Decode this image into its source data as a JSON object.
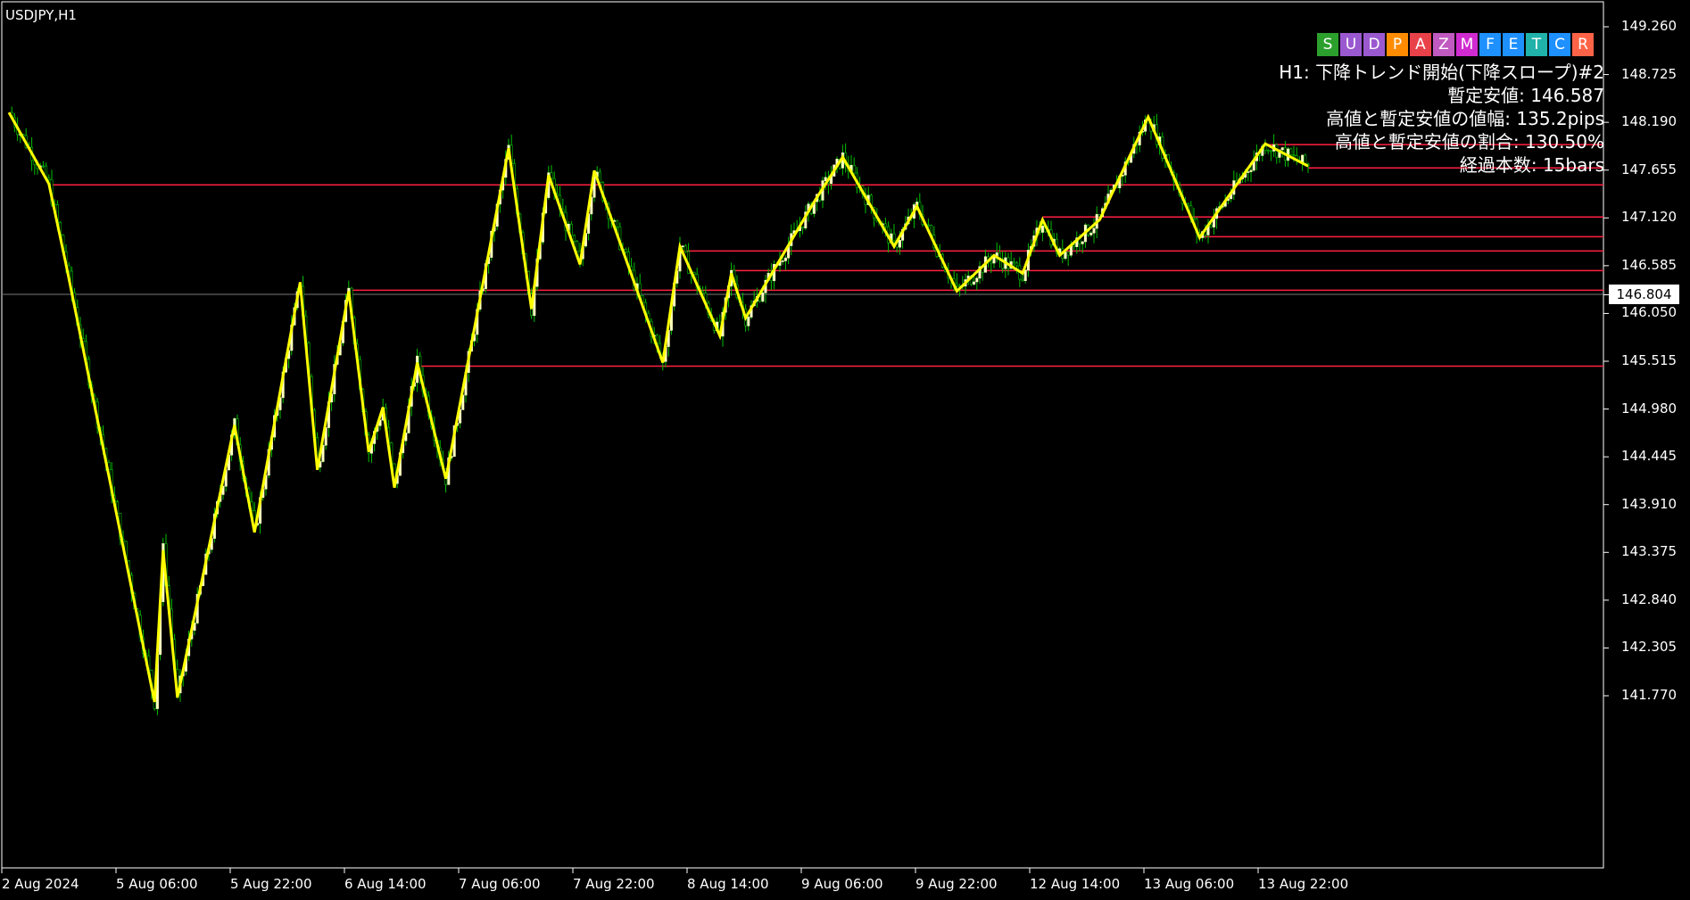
{
  "window": {
    "symbol_title": "USDJPY,H1"
  },
  "price_axis": {
    "ticks": [
      "149.260",
      "148.725",
      "148.190",
      "147.655",
      "147.120",
      "146.585",
      "146.050",
      "145.515",
      "144.980",
      "144.445",
      "143.910",
      "143.375",
      "142.840",
      "142.305",
      "141.770"
    ],
    "current_price": "146.804"
  },
  "time_axis": {
    "labels": [
      "2 Aug 2024",
      "5 Aug 06:00",
      "5 Aug 22:00",
      "6 Aug 14:00",
      "7 Aug 06:00",
      "7 Aug 22:00",
      "8 Aug 14:00",
      "9 Aug 06:00",
      "9 Aug 22:00",
      "12 Aug 14:00",
      "13 Aug 06:00",
      "13 Aug 22:00"
    ]
  },
  "indicator_buttons": [
    {
      "label": "S",
      "color": "#2ca02c"
    },
    {
      "label": "U",
      "color": "#9b59d0"
    },
    {
      "label": "D",
      "color": "#9b59d0"
    },
    {
      "label": "P",
      "color": "#ff8c00"
    },
    {
      "label": "A",
      "color": "#e8414a"
    },
    {
      "label": "Z",
      "color": "#c05ac0"
    },
    {
      "label": "M",
      "color": "#d02bd0"
    },
    {
      "label": "F",
      "color": "#1e90ff"
    },
    {
      "label": "E",
      "color": "#1e90ff"
    },
    {
      "label": "T",
      "color": "#20b2aa"
    },
    {
      "label": "C",
      "color": "#1e90ff"
    },
    {
      "label": "R",
      "color": "#ff6347"
    }
  ],
  "info_panel": {
    "line1": "H1: 下降トレンド開始(下降スロープ)#2",
    "line2": "暫定安値: 146.587",
    "line3": "高値と暫定安値の値幅: 135.2pips",
    "line4": "高値と暫定安値の割合: 130.50%",
    "line5": "経過本数: 15bars"
  },
  "colors": {
    "background": "#000000",
    "bull_candle": "#ffffc0",
    "bear_wick": "#00c000",
    "zigzag": "#ffff00",
    "level_line": "#ff2040",
    "axis": "#ffffff"
  },
  "chart_data": {
    "type": "candlestick",
    "symbol": "USDJPY",
    "timeframe": "H1",
    "ylim": [
      141.6,
      149.4
    ],
    "horizontal_levels": [
      147.94,
      147.68,
      147.49,
      147.13,
      146.91,
      146.75,
      146.53,
      146.31,
      145.46
    ],
    "zigzag": [
      {
        "t": 0,
        "p": 148.3
      },
      {
        "t": 14,
        "p": 147.5
      },
      {
        "t": 20,
        "p": 146.6
      },
      {
        "t": 51,
        "p": 141.7
      },
      {
        "t": 54,
        "p": 143.4
      },
      {
        "t": 59,
        "p": 141.75
      },
      {
        "t": 79,
        "p": 144.8
      },
      {
        "t": 86,
        "p": 143.6
      },
      {
        "t": 102,
        "p": 146.4
      },
      {
        "t": 108,
        "p": 144.3
      },
      {
        "t": 119,
        "p": 146.3
      },
      {
        "t": 126,
        "p": 144.5
      },
      {
        "t": 131,
        "p": 145.0
      },
      {
        "t": 135,
        "p": 144.1
      },
      {
        "t": 143,
        "p": 145.5
      },
      {
        "t": 153,
        "p": 144.2
      },
      {
        "t": 175,
        "p": 147.9
      },
      {
        "t": 183,
        "p": 146.1
      },
      {
        "t": 189,
        "p": 147.6
      },
      {
        "t": 200,
        "p": 146.6
      },
      {
        "t": 205,
        "p": 147.65
      },
      {
        "t": 229,
        "p": 145.5
      },
      {
        "t": 235,
        "p": 146.8
      },
      {
        "t": 249,
        "p": 145.8
      },
      {
        "t": 253,
        "p": 146.5
      },
      {
        "t": 258,
        "p": 146.0
      },
      {
        "t": 282,
        "p": 147.3
      },
      {
        "t": 292,
        "p": 147.8
      },
      {
        "t": 310,
        "p": 146.8
      },
      {
        "t": 318,
        "p": 147.25
      },
      {
        "t": 332,
        "p": 146.3
      },
      {
        "t": 345,
        "p": 146.7
      },
      {
        "t": 355,
        "p": 146.5
      },
      {
        "t": 362,
        "p": 147.1
      },
      {
        "t": 368,
        "p": 146.7
      },
      {
        "t": 382,
        "p": 147.1
      },
      {
        "t": 399,
        "p": 148.25
      },
      {
        "t": 417,
        "p": 146.9
      },
      {
        "t": 440,
        "p": 147.95
      },
      {
        "t": 455,
        "p": 147.7
      }
    ]
  }
}
